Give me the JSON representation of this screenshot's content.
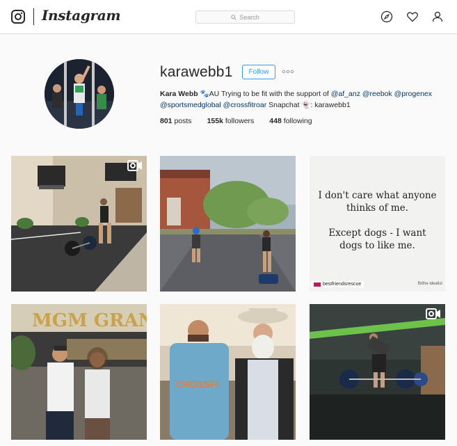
{
  "header": {
    "wordmark": "Instagram",
    "search_placeholder": "Search",
    "icons": [
      "instagram-logo-icon",
      "search-icon",
      "compass-icon",
      "heart-icon",
      "person-icon"
    ]
  },
  "profile": {
    "username": "karawebb1",
    "follow_label": "Follow",
    "more_label": "•••",
    "full_name": "Kara Webb",
    "bio_flag": "🐾AU",
    "bio_text": "Trying to be fit with the support of",
    "bio_mention_1": "@af_anz",
    "bio_mention_2": "@reebok",
    "bio_mention_3": "@progenex",
    "bio_mention_4": "@sportsmedglobal",
    "bio_mention_5": "@crossfitroar",
    "bio_tail": "Snapchat 👻: karawebb1",
    "stats": {
      "posts_count": "801",
      "posts_label": "posts",
      "followers_count": "155k",
      "followers_label": "followers",
      "following_count": "448",
      "following_label": "following"
    }
  },
  "posts": [
    {
      "type": "video"
    },
    {
      "type": "photo"
    },
    {
      "type": "quote",
      "lines_1": [
        "I don't care what anyone",
        "thinks of me."
      ],
      "lines_2": [
        "Except dogs - I want",
        "dogs to like me."
      ],
      "credit_left": "bestfriendsrescue",
      "credit_right": "fb/the idealist"
    },
    {
      "type": "photo",
      "sign_text": "MGM GRAND"
    },
    {
      "type": "photo",
      "shirt_text": "CROSSFI"
    },
    {
      "type": "video"
    }
  ],
  "colors": {
    "accent_blue": "#3897f0",
    "link_blue": "#003569",
    "border": "#dbdbdb",
    "background": "#fafafa"
  }
}
